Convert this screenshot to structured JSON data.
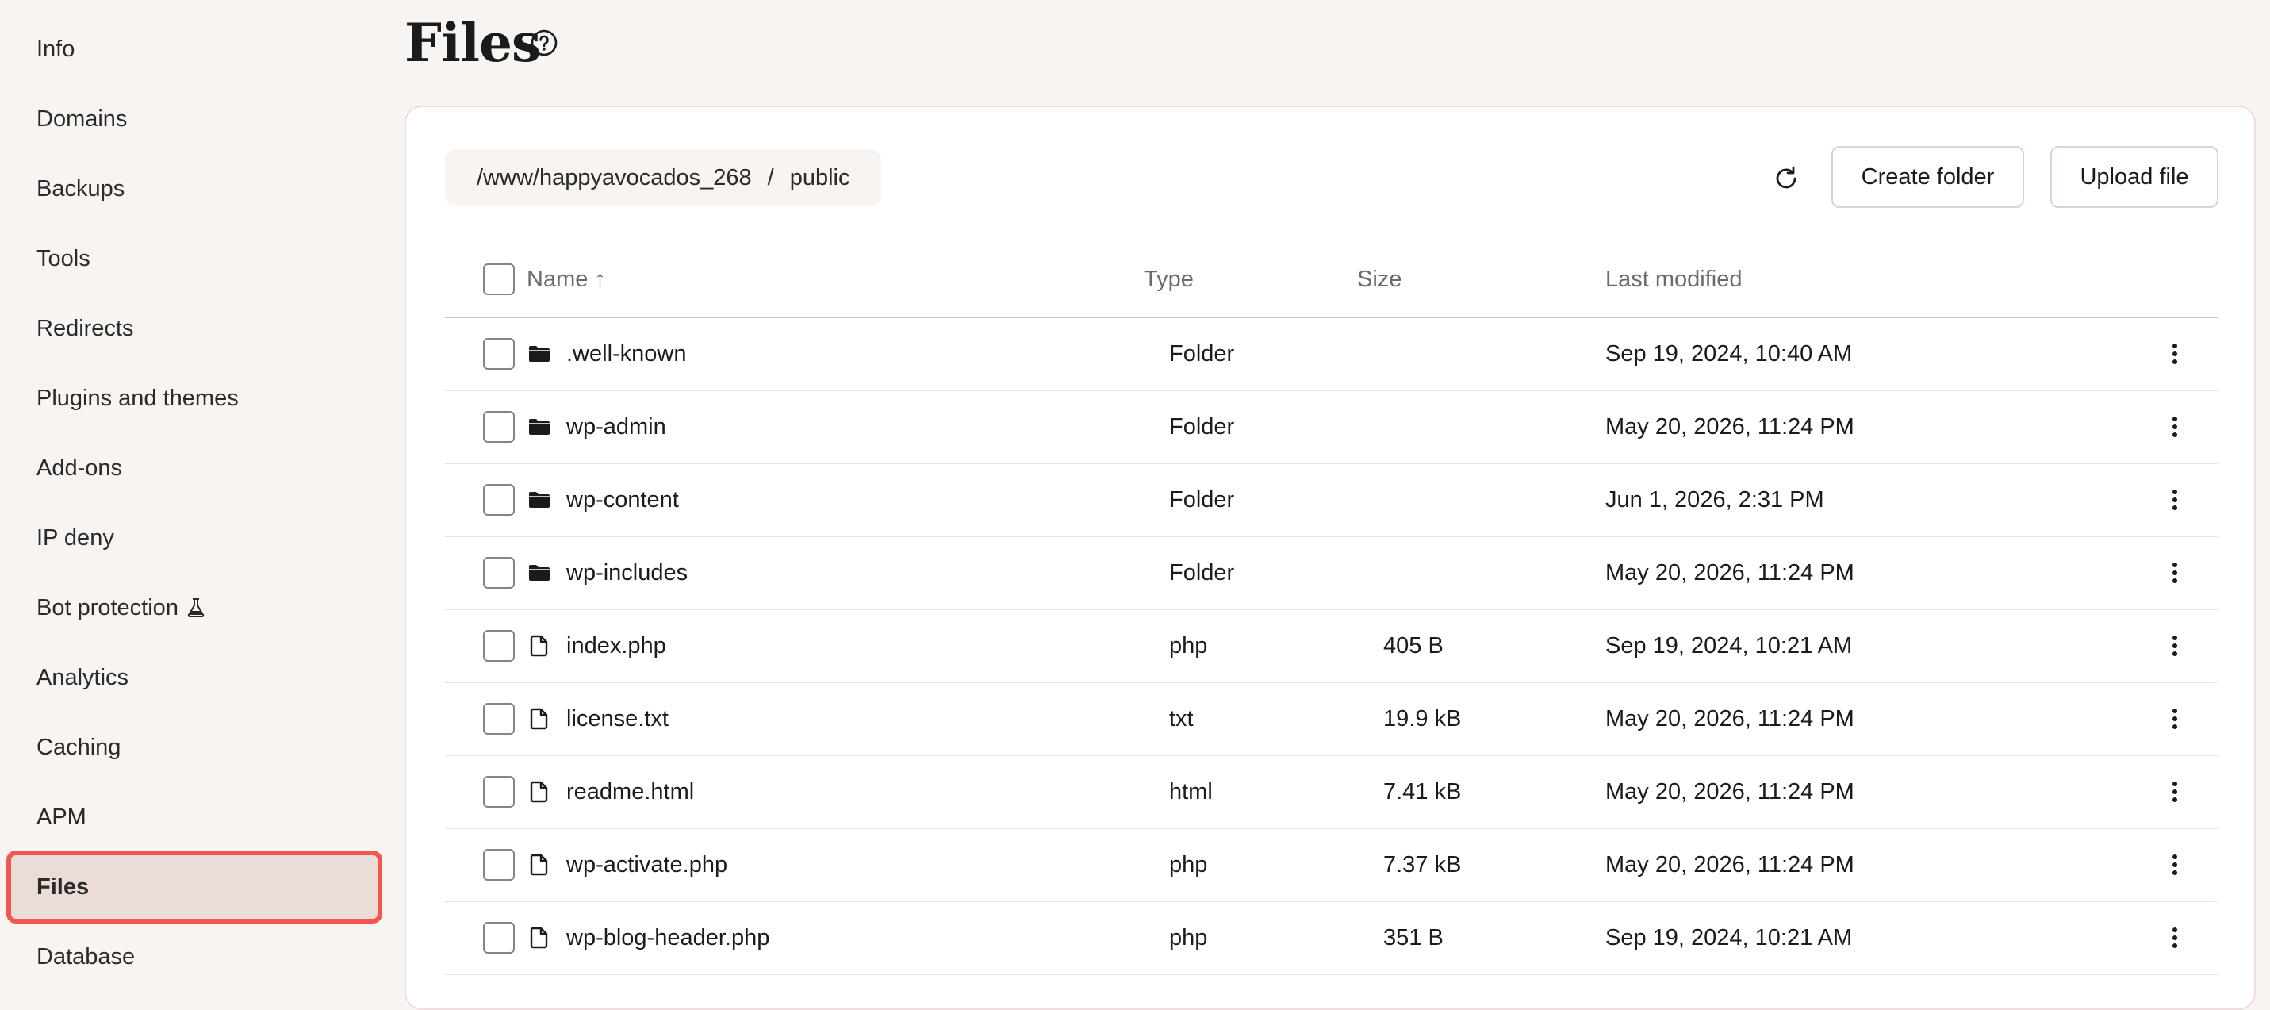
{
  "sidebar": {
    "items": [
      {
        "label": "Info"
      },
      {
        "label": "Domains"
      },
      {
        "label": "Backups"
      },
      {
        "label": "Tools"
      },
      {
        "label": "Redirects"
      },
      {
        "label": "Plugins and themes"
      },
      {
        "label": "Add-ons"
      },
      {
        "label": "IP deny"
      },
      {
        "label": "Bot protection",
        "icon": "flask-icon"
      },
      {
        "label": "Analytics"
      },
      {
        "label": "Caching"
      },
      {
        "label": "APM"
      },
      {
        "label": "Files",
        "active": true
      },
      {
        "label": "Database"
      }
    ]
  },
  "header": {
    "title": "Files",
    "help_icon": "help-circle-icon"
  },
  "breadcrumb": {
    "path": "/www/happyavocados_268",
    "separator": "/",
    "current": "public"
  },
  "toolbar": {
    "refresh_icon": "refresh-icon",
    "create_folder_label": "Create folder",
    "upload_file_label": "Upload file"
  },
  "table": {
    "columns": {
      "name": "Name ↑",
      "type": "Type",
      "size": "Size",
      "last_modified": "Last modified"
    },
    "rows": [
      {
        "name": ".well-known",
        "kind": "folder",
        "type": "Folder",
        "size": "",
        "modified": "Sep 19, 2024, 10:40 AM"
      },
      {
        "name": "wp-admin",
        "kind": "folder",
        "type": "Folder",
        "size": "",
        "modified": "May 20, 2026, 11:24 PM"
      },
      {
        "name": "wp-content",
        "kind": "folder",
        "type": "Folder",
        "size": "",
        "modified": "Jun 1, 2026, 2:31 PM"
      },
      {
        "name": "wp-includes",
        "kind": "folder",
        "type": "Folder",
        "size": "",
        "modified": "May 20, 2026, 11:24 PM"
      },
      {
        "name": "index.php",
        "kind": "file",
        "type": "php",
        "size": "405 B",
        "modified": "Sep 19, 2024, 10:21 AM"
      },
      {
        "name": "license.txt",
        "kind": "file",
        "type": "txt",
        "size": "19.9 kB",
        "modified": "May 20, 2026, 11:24 PM"
      },
      {
        "name": "readme.html",
        "kind": "file",
        "type": "html",
        "size": "7.41 kB",
        "modified": "May 20, 2026, 11:24 PM"
      },
      {
        "name": "wp-activate.php",
        "kind": "file",
        "type": "php",
        "size": "7.37 kB",
        "modified": "May 20, 2026, 11:24 PM"
      },
      {
        "name": "wp-blog-header.php",
        "kind": "file",
        "type": "php",
        "size": "351 B",
        "modified": "Sep 19, 2024, 10:21 AM"
      }
    ]
  },
  "colors": {
    "page_bg": "#f8f4f1",
    "active_outline": "#f2574f",
    "active_bg": "#ecdcd7",
    "row_divider": "#efdede"
  }
}
